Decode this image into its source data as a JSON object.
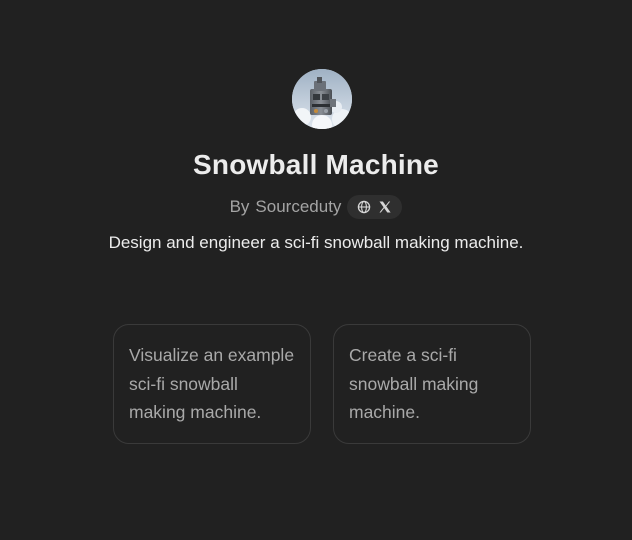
{
  "gpt": {
    "name": "Snowball Machine",
    "byline_prefix": "By",
    "author": "Sourceduty",
    "description": "Design and engineer a sci-fi snowball making machine.",
    "avatar_icon": "snowball-machine-avatar",
    "social_icons": [
      "globe-icon",
      "x-logo-icon"
    ]
  },
  "conversation_starters": [
    {
      "text": "Visualize an example sci-fi snowball making machine."
    },
    {
      "text": "Create a sci-fi snowball making machine."
    }
  ],
  "colors": {
    "background": "#212121",
    "title": "#ececec",
    "muted": "#a4a4a4",
    "card_border": "#3a3a3a",
    "pill": "#2f2f2f"
  }
}
